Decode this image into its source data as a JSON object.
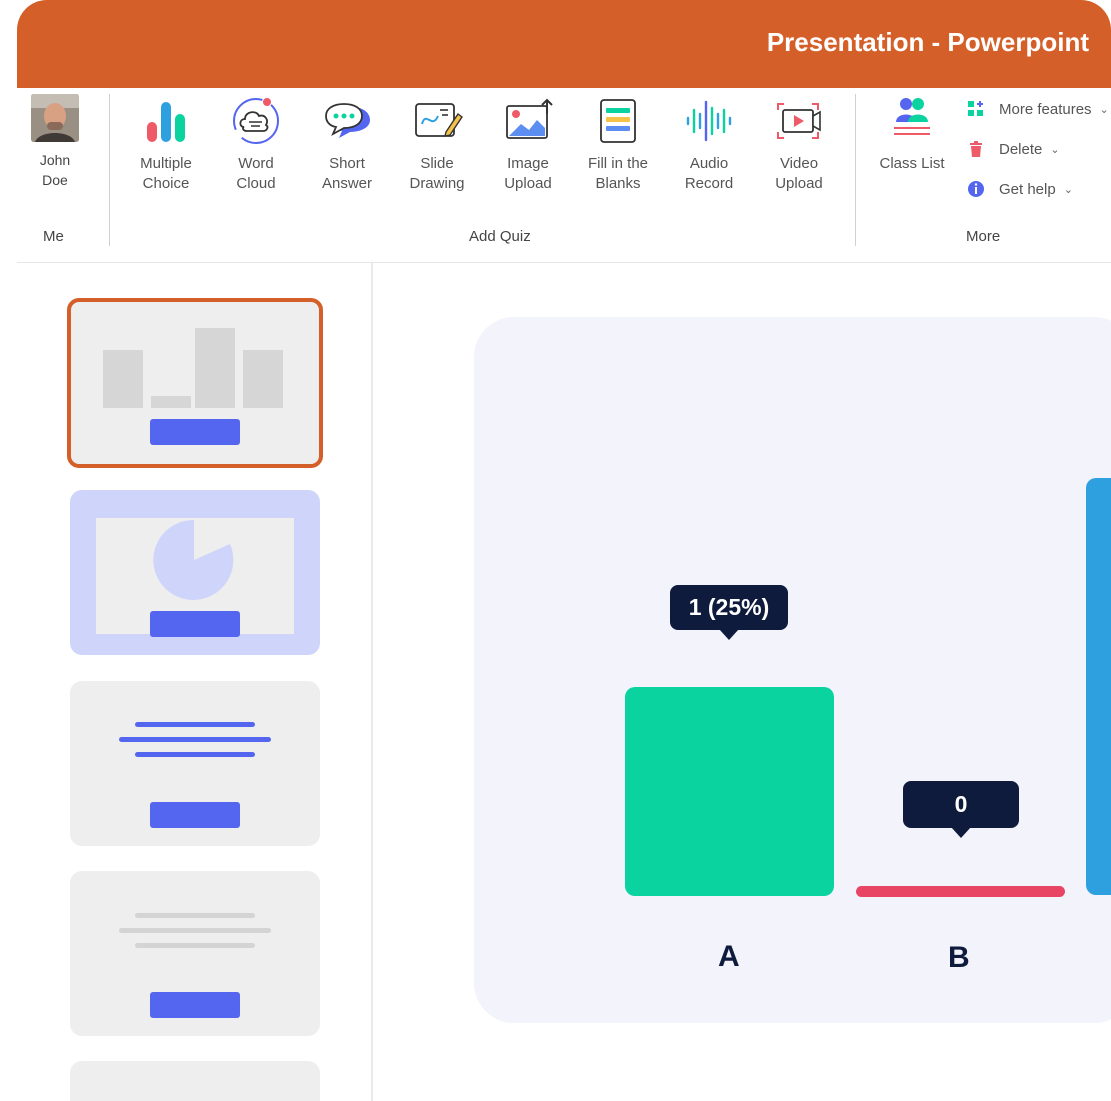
{
  "window": {
    "title": "Presentation - Powerpoint",
    "accent": "#d55f28"
  },
  "ribbon": {
    "me": {
      "name_line1": "John",
      "name_line2": "Doe",
      "group_label": "Me"
    },
    "add_quiz": {
      "group_label": "Add Quiz",
      "buttons": [
        {
          "line1": "Multiple",
          "line2": "Choice",
          "icon": "bar-chart-icon"
        },
        {
          "line1": "Word",
          "line2": "Cloud",
          "icon": "word-cloud-icon"
        },
        {
          "line1": "Short",
          "line2": "Answer",
          "icon": "speech-bubble-icon"
        },
        {
          "line1": "Slide",
          "line2": "Drawing",
          "icon": "drawing-pen-icon"
        },
        {
          "line1": "Image",
          "line2": "Upload",
          "icon": "image-upload-icon"
        },
        {
          "line1": "Fill in the",
          "line2": "Blanks",
          "icon": "fill-blanks-icon"
        },
        {
          "line1": "Audio",
          "line2": "Record",
          "icon": "audio-wave-icon"
        },
        {
          "line1": "Video",
          "line2": "Upload",
          "icon": "video-upload-icon"
        }
      ]
    },
    "more": {
      "group_label": "More",
      "class_list": "Class List",
      "items": [
        {
          "label": "More features",
          "icon": "grid-plus-icon"
        },
        {
          "label": "Delete",
          "icon": "trash-icon"
        },
        {
          "label": "Get help",
          "icon": "info-icon"
        }
      ]
    }
  },
  "chart": {
    "bars": [
      {
        "category": "A",
        "tooltip": "1 (25%)",
        "color": "#0ad3a0"
      },
      {
        "category": "B",
        "tooltip": "0",
        "color": "#e84564"
      },
      {
        "category": "",
        "tooltip": "",
        "color": "#2ea0e0"
      }
    ]
  }
}
